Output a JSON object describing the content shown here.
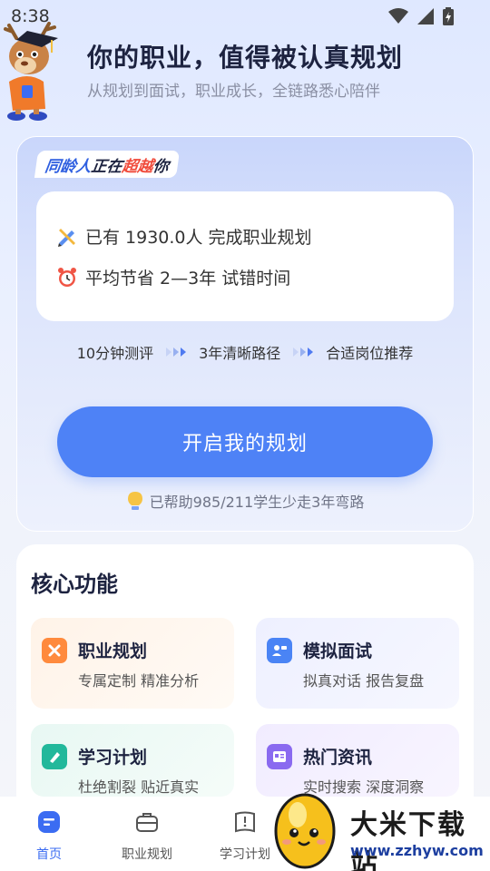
{
  "status": {
    "time": "8:38"
  },
  "header": {
    "title": "你的职业，值得被认真规划",
    "subtitle": "从规划到面试，职业成长，全链路悉心陪伴"
  },
  "hero": {
    "tag_part1": "同龄人",
    "tag_part2": "正在",
    "tag_part3": "超越",
    "tag_part4": "你",
    "stat1": "已有 1930.0人 完成职业规划",
    "stat2": "平均节省 2—3年 试错时间",
    "steps": [
      "10分钟测评",
      "3年清晰路径",
      "合适岗位推荐"
    ],
    "cta_label": "开启我的规划",
    "helped_text": "已帮助985/211学生少走3年弯路"
  },
  "core": {
    "title": "核心功能",
    "features": [
      {
        "name": "职业规划",
        "desc": "专属定制 精准分析",
        "icon": "career-icon",
        "color": "#ff8a3d"
      },
      {
        "name": "模拟面试",
        "desc": "拟真对话 报告复盘",
        "icon": "interview-icon",
        "color": "#4a84f5"
      },
      {
        "name": "学习计划",
        "desc": "杜绝割裂 贴近真实",
        "icon": "study-icon",
        "color": "#22b89b"
      },
      {
        "name": "热门资讯",
        "desc": "实时搜索 深度洞察",
        "icon": "news-icon",
        "color": "#8a6af0"
      }
    ]
  },
  "nav": {
    "items": [
      {
        "label": "首页",
        "icon": "home-icon"
      },
      {
        "label": "职业规划",
        "icon": "briefcase-icon"
      },
      {
        "label": "学习计划",
        "icon": "book-icon"
      }
    ]
  },
  "watermark": {
    "text": "大米下载站",
    "url": "www.zzhyw.com"
  }
}
